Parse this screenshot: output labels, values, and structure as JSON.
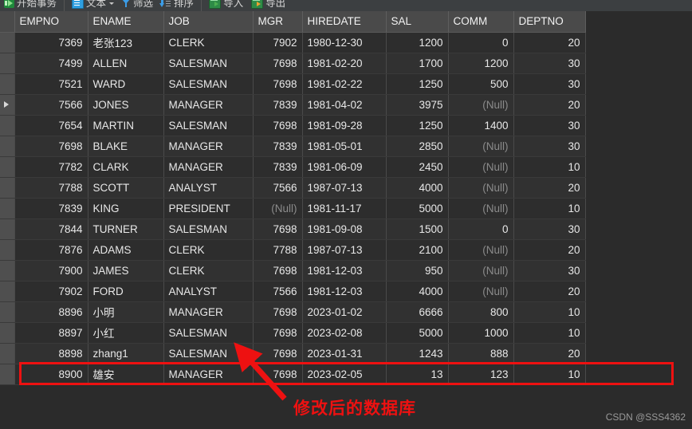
{
  "toolbar": {
    "items": [
      {
        "label": "开始事务",
        "icon": "play-icon",
        "has_caret": false
      },
      {
        "label": "文本",
        "icon": "text-document-icon",
        "has_caret": true
      },
      {
        "label": "筛选",
        "icon": "funnel-filter-icon",
        "has_caret": false
      },
      {
        "label": "排序",
        "icon": "sort-descending-icon",
        "has_caret": false
      },
      {
        "label": "导入",
        "icon": "import-table-icon",
        "has_caret": false
      },
      {
        "label": "导出",
        "icon": "export-table-icon",
        "has_caret": false
      }
    ]
  },
  "grid": {
    "columns": [
      "EMPNO",
      "ENAME",
      "JOB",
      "MGR",
      "HIREDATE",
      "SAL",
      "COMM",
      "DEPTNO"
    ],
    "null_text": "(Null)",
    "current_row_index": 3,
    "highlighted_row_index": 17,
    "rows": [
      {
        "EMPNO": "7369",
        "ENAME": "老张123",
        "JOB": "CLERK",
        "MGR": "7902",
        "HIREDATE": "1980-12-30",
        "SAL": "1200",
        "COMM": "0",
        "DEPTNO": "20"
      },
      {
        "EMPNO": "7499",
        "ENAME": "ALLEN",
        "JOB": "SALESMAN",
        "MGR": "7698",
        "HIREDATE": "1981-02-20",
        "SAL": "1700",
        "COMM": "1200",
        "DEPTNO": "30"
      },
      {
        "EMPNO": "7521",
        "ENAME": "WARD",
        "JOB": "SALESMAN",
        "MGR": "7698",
        "HIREDATE": "1981-02-22",
        "SAL": "1250",
        "COMM": "500",
        "DEPTNO": "30"
      },
      {
        "EMPNO": "7566",
        "ENAME": "JONES",
        "JOB": "MANAGER",
        "MGR": "7839",
        "HIREDATE": "1981-04-02",
        "SAL": "3975",
        "COMM": "(Null)",
        "DEPTNO": "20"
      },
      {
        "EMPNO": "7654",
        "ENAME": "MARTIN",
        "JOB": "SALESMAN",
        "MGR": "7698",
        "HIREDATE": "1981-09-28",
        "SAL": "1250",
        "COMM": "1400",
        "DEPTNO": "30"
      },
      {
        "EMPNO": "7698",
        "ENAME": "BLAKE",
        "JOB": "MANAGER",
        "MGR": "7839",
        "HIREDATE": "1981-05-01",
        "SAL": "2850",
        "COMM": "(Null)",
        "DEPTNO": "30"
      },
      {
        "EMPNO": "7782",
        "ENAME": "CLARK",
        "JOB": "MANAGER",
        "MGR": "7839",
        "HIREDATE": "1981-06-09",
        "SAL": "2450",
        "COMM": "(Null)",
        "DEPTNO": "10"
      },
      {
        "EMPNO": "7788",
        "ENAME": "SCOTT",
        "JOB": "ANALYST",
        "MGR": "7566",
        "HIREDATE": "1987-07-13",
        "SAL": "4000",
        "COMM": "(Null)",
        "DEPTNO": "20"
      },
      {
        "EMPNO": "7839",
        "ENAME": "KING",
        "JOB": "PRESIDENT",
        "MGR": "(Null)",
        "HIREDATE": "1981-11-17",
        "SAL": "5000",
        "COMM": "(Null)",
        "DEPTNO": "10"
      },
      {
        "EMPNO": "7844",
        "ENAME": "TURNER",
        "JOB": "SALESMAN",
        "MGR": "7698",
        "HIREDATE": "1981-09-08",
        "SAL": "1500",
        "COMM": "0",
        "DEPTNO": "30"
      },
      {
        "EMPNO": "7876",
        "ENAME": "ADAMS",
        "JOB": "CLERK",
        "MGR": "7788",
        "HIREDATE": "1987-07-13",
        "SAL": "2100",
        "COMM": "(Null)",
        "DEPTNO": "20"
      },
      {
        "EMPNO": "7900",
        "ENAME": "JAMES",
        "JOB": "CLERK",
        "MGR": "7698",
        "HIREDATE": "1981-12-03",
        "SAL": "950",
        "COMM": "(Null)",
        "DEPTNO": "30"
      },
      {
        "EMPNO": "7902",
        "ENAME": "FORD",
        "JOB": "ANALYST",
        "MGR": "7566",
        "HIREDATE": "1981-12-03",
        "SAL": "4000",
        "COMM": "(Null)",
        "DEPTNO": "20"
      },
      {
        "EMPNO": "8896",
        "ENAME": "小明",
        "JOB": "MANAGER",
        "MGR": "7698",
        "HIREDATE": "2023-01-02",
        "SAL": "6666",
        "COMM": "800",
        "DEPTNO": "10"
      },
      {
        "EMPNO": "8897",
        "ENAME": "小红",
        "JOB": "SALESMAN",
        "MGR": "7698",
        "HIREDATE": "2023-02-08",
        "SAL": "5000",
        "COMM": "1000",
        "DEPTNO": "10"
      },
      {
        "EMPNO": "8898",
        "ENAME": "zhang1",
        "JOB": "SALESMAN",
        "MGR": "7698",
        "HIREDATE": "2023-01-31",
        "SAL": "1243",
        "COMM": "888",
        "DEPTNO": "20"
      },
      {
        "EMPNO": "8900",
        "ENAME": "雄安",
        "JOB": "MANAGER",
        "MGR": "7698",
        "HIREDATE": "2023-02-05",
        "SAL": "13",
        "COMM": "123",
        "DEPTNO": "10"
      }
    ]
  },
  "annotation": {
    "text": "修改后的数据库",
    "color": "#ee1111"
  },
  "watermark": "CSDN @SSS4362"
}
